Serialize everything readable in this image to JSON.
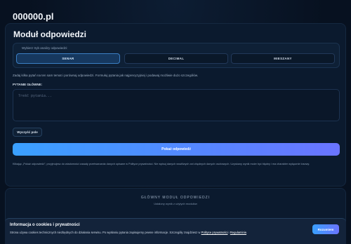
{
  "header": {
    "brand": "000000.pl"
  },
  "main": {
    "title": "Moduł odpowiedzi",
    "mode_hint": "Wybierz tryb analizy odpowiedzi:",
    "modes": [
      {
        "label": "SENAR",
        "active": true
      },
      {
        "label": "DECIMAL",
        "active": false
      },
      {
        "label": "MIESZANY",
        "active": false
      }
    ],
    "instruction": "Zadaj kilka pytań na ten sam temat i porównaj odpowiedzi. Formułuj pytania jak najprecyzyjniej i podawaj możliwie dużo szczegółów.",
    "question_label": "PYTANIE GŁÓWNE:",
    "question_placeholder": "Treść pytania...",
    "clear_button": "Wyczyść pole",
    "show_button": "Pokaż odpowiedź",
    "disclaimer": "Klikając „Pokaż odpowiedź”, przyjmujesz do wiadomości zasady przetwarzania danych opisane w Polityce prywatności. Nie wpisuj danych wrażliwych ani zbędnych danych osobowych. Uzyskany wynik może być błędny i ma charakter wyłącznie losowy."
  },
  "secondary": {
    "title": "GŁÓWNY MODUŁ ODPOWIEDZI",
    "subtitle": "Ustalony wynik z użytych modułów"
  },
  "cookie": {
    "title": "Informacja o cookies i prywatności",
    "text_before": "Strona używa cookies technicznych niezbędnych do działania serwisu. Po wysłaniu pytania zapisujemy pewne informacje. Szczegóły znajdziesz w ",
    "link_privacy": "Polityce prywatności",
    "text_and": " i ",
    "link_terms": "Regulaminie",
    "text_after": ".",
    "accept_button": "Rozumiem"
  }
}
